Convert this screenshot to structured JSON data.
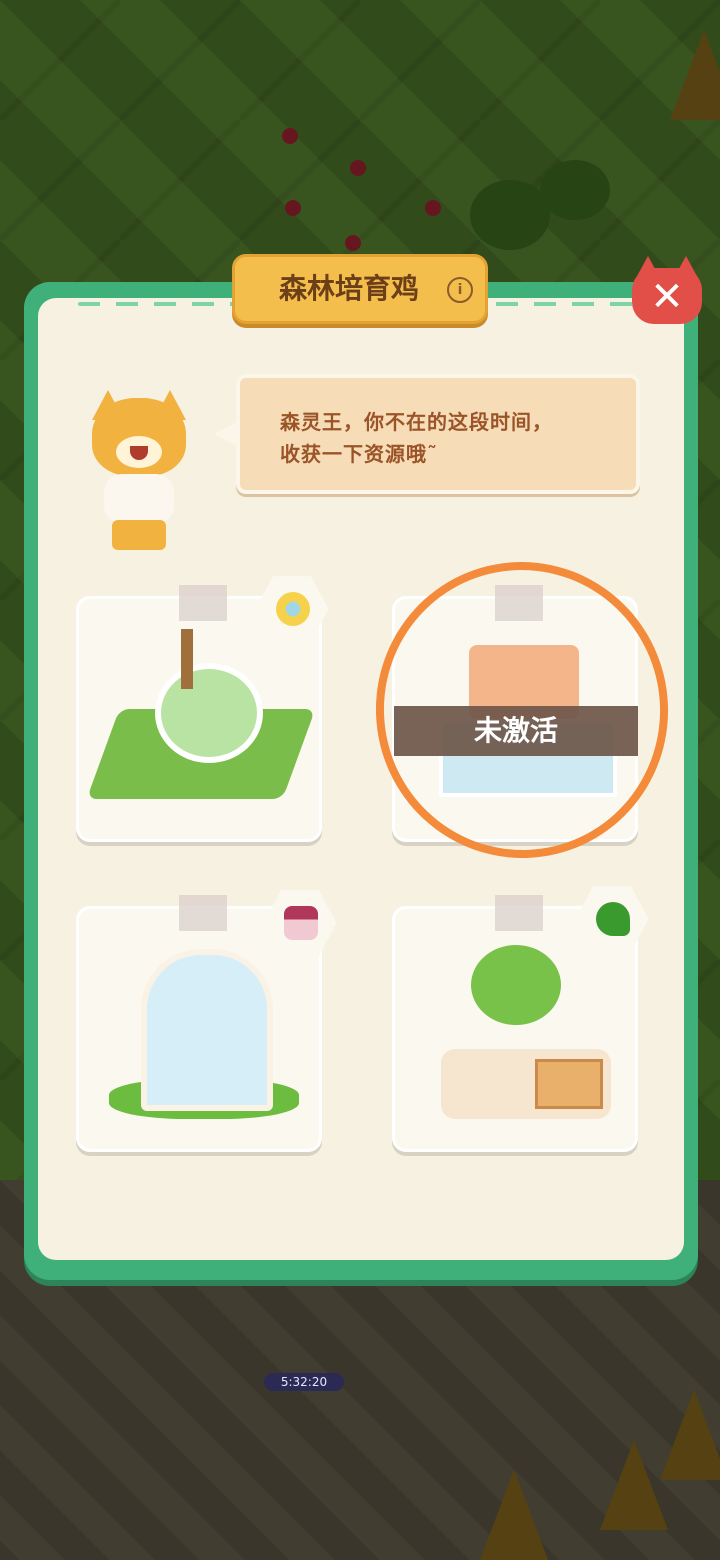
{
  "dialog": {
    "title": "森林培育鸡",
    "info_icon": "info-icon",
    "close_icon": "close-icon"
  },
  "speech": {
    "line1": "森灵王，你不在的这段时间，",
    "line2": "收获一下资源哦˜"
  },
  "buildings": [
    {
      "name": "well",
      "resource_icon": "spiral-orb-icon",
      "active": true
    },
    {
      "name": "shop",
      "resource_icon": "none",
      "active": false,
      "status_label": "未激活"
    },
    {
      "name": "greenhouse-rack",
      "resource_icon": "jam-jar-icon",
      "active": true
    },
    {
      "name": "slime-statue",
      "resource_icon": "clover-sprout-icon",
      "active": true
    }
  ],
  "background": {
    "timer_text": "5:32:20"
  },
  "colors": {
    "frame_green": "#3fb07a",
    "panel_cream": "#f7f1e2",
    "title_gold": "#f4be4d",
    "close_red": "#e24e48",
    "annotation_orange": "#f38b3a"
  }
}
